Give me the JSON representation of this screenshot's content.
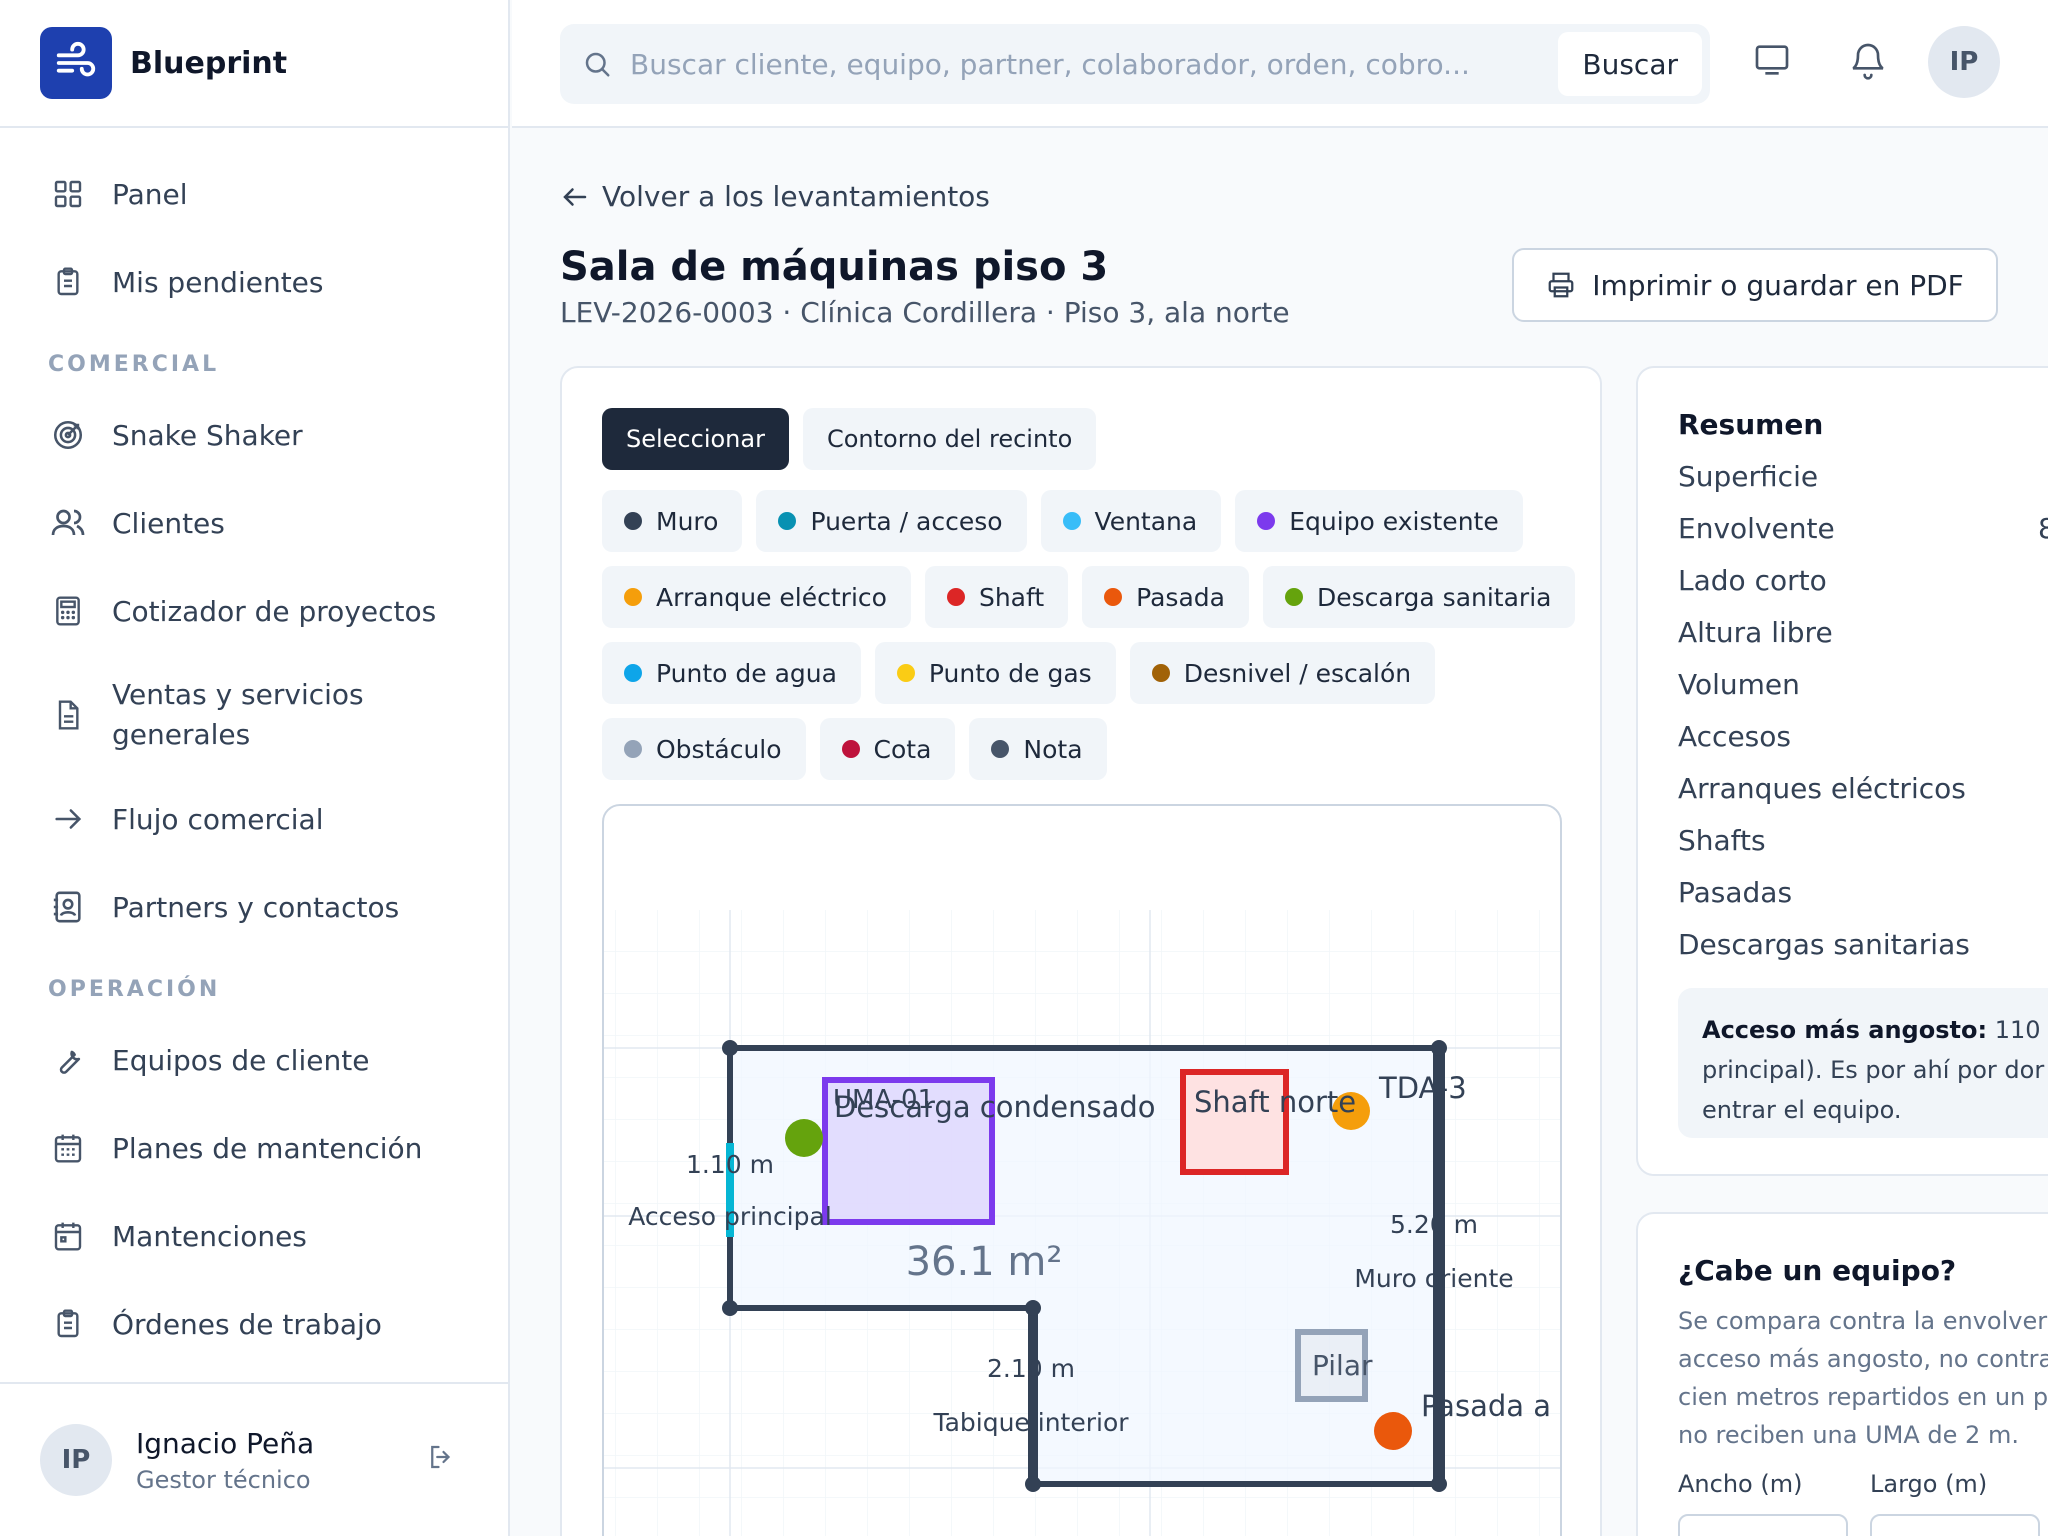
{
  "app": {
    "name": "Blueprint"
  },
  "search": {
    "placeholder": "Buscar cliente, equipo, partner, colaborador, orden, cobro...",
    "button_label": "Buscar"
  },
  "topbar": {
    "avatar_initials": "IP"
  },
  "sidebar": {
    "items_top": [
      {
        "label": "Panel",
        "icon": "grid-icon"
      },
      {
        "label": "Mis pendientes",
        "icon": "clipboard-icon"
      }
    ],
    "section_comercial": "COMERCIAL",
    "items_comercial": [
      {
        "label": "Snake Shaker",
        "icon": "target-icon"
      },
      {
        "label": "Clientes",
        "icon": "users-icon"
      },
      {
        "label": "Cotizador de proyectos",
        "icon": "calculator-icon"
      },
      {
        "label": "Ventas y servicios generales",
        "icon": "document-icon"
      },
      {
        "label": "Flujo comercial",
        "icon": "arrow-right-icon"
      },
      {
        "label": "Partners y contactos",
        "icon": "contact-icon"
      }
    ],
    "section_operacion": "OPERACIÓN",
    "items_operacion": [
      {
        "label": "Equipos de cliente",
        "icon": "wrench-icon"
      },
      {
        "label": "Planes de mantención",
        "icon": "calendar-grid-icon"
      },
      {
        "label": "Mantenciones",
        "icon": "calendar-icon"
      },
      {
        "label": "Órdenes de trabajo",
        "icon": "clipboard-icon"
      }
    ]
  },
  "user": {
    "initials": "IP",
    "name": "Ignacio Peña",
    "role": "Gestor técnico"
  },
  "page": {
    "back_label": "Volver a los levantamientos",
    "title": "Sala de máquinas piso 3",
    "subtitle": "LEV-2026-0003 · Clínica Cordillera · Piso 3, ala norte",
    "print_label": "Imprimir o guardar en PDF"
  },
  "editor": {
    "tools": [
      "Seleccionar",
      "Contorno del recinto"
    ],
    "elements": [
      {
        "label": "Muro",
        "color": "#334155"
      },
      {
        "label": "Puerta / acceso",
        "color": "#0891b2"
      },
      {
        "label": "Ventana",
        "color": "#38bdf8"
      },
      {
        "label": "Equipo existente",
        "color": "#7c3aed"
      },
      {
        "label": "Arranque eléctrico",
        "color": "#f59e0b"
      },
      {
        "label": "Shaft",
        "color": "#dc2626"
      },
      {
        "label": "Pasada",
        "color": "#ea580c"
      },
      {
        "label": "Descarga sanitaria",
        "color": "#65a30d"
      },
      {
        "label": "Punto de agua",
        "color": "#0ea5e9"
      },
      {
        "label": "Punto de gas",
        "color": "#facc15"
      },
      {
        "label": "Desnivel / escalón",
        "color": "#a16207"
      },
      {
        "label": "Obstáculo",
        "color": "#94a3b8"
      },
      {
        "label": "Cota",
        "color": "#be123c"
      },
      {
        "label": "Nota",
        "color": "#475569"
      }
    ],
    "plan": {
      "area": "36.1 m²",
      "uma_label": "UMA-01",
      "descarga_label": "Descarga condensado",
      "shaft_label": "Shaft norte",
      "tda_label": "TDA-3",
      "pilar_label": "Pilar",
      "pasada_label": "Pasada a",
      "dim_acceso": "1.10 m",
      "acceso_label": "Acceso principal",
      "dim_oriente": "5.20 m",
      "oriente_label": "Muro oriente",
      "dim_tabique": "2.10 m",
      "tabique_label": "Tabique interior"
    }
  },
  "summary": {
    "title": "Resumen",
    "rows": [
      {
        "label": "Superficie",
        "value": ""
      },
      {
        "label": "Envolvente",
        "value": "8"
      },
      {
        "label": "Lado corto",
        "value": ""
      },
      {
        "label": "Altura libre",
        "value": ""
      },
      {
        "label": "Volumen",
        "value": ""
      },
      {
        "label": "Accesos",
        "value": ""
      },
      {
        "label": "Arranques eléctricos",
        "value": ""
      },
      {
        "label": "Shafts",
        "value": ""
      },
      {
        "label": "Pasadas",
        "value": ""
      },
      {
        "label": "Descargas sanitarias",
        "value": ""
      }
    ],
    "note_bold": "Acceso más angosto:",
    "note_line1": "110",
    "note_line2": "principal). Es por ahí por dor",
    "note_line3": "entrar el equipo."
  },
  "fit": {
    "title": "¿Cabe un equipo?",
    "desc_lines": [
      "Se compara contra la envolver",
      "acceso más angosto, no contra",
      "cien metros repartidos en un p",
      "no reciben una UMA de 2 m."
    ],
    "width_label": "Ancho (m)",
    "length_label": "Largo (m)"
  }
}
